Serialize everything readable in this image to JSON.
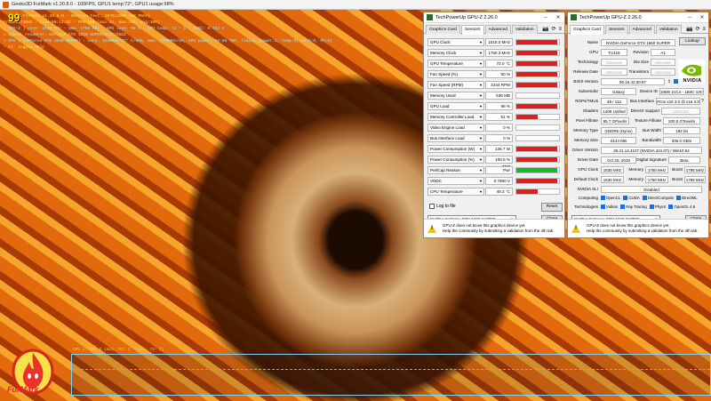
{
  "furmark": {
    "title": "Geeks3D FurMark v1.20.8.0 - 100FPS, GPU1 temp:72°, GPU1 usage:98%",
    "fps": "99",
    "lines": [
      "FurMark v1.20.8.0 - Burn-in test, 1576x1080 (0X MSAA)",
      "Frames:74882 - time:00:12:42 - FPS:100 (min:61, max:109, avg:100)",
      "[ GPU-Z ] core: 1530 MHz - mem: 1750 MHz - GPU load: 99 % - GPU temp: 72 ° C - VDDC: 0.762 V",
      "> OpenGL renderer: GeForce GTX 1660 SUPER/PCIe/SSE2",
      "> GPU 1 (GeForce GTX 1660 SUPER) - core: 1530MHz/72° C/99%, mem: 1750MHz/6%, GPU power: 99.5% TDP, limits:[power:1, temp:0, volt:0, OV:0]",
      "- F1: toggle help"
    ],
    "graph_label": "GPU 1: 72° C (min: 53° C - max: 73° C)",
    "logo_text": "FurMark"
  },
  "gpuz_sensors": {
    "title": "TechPowerUp GPU-Z 2.26.0",
    "tabs": [
      "Graphics Card",
      "Sensors",
      "Advanced",
      "Validation"
    ],
    "active_tab": 1,
    "sensors": [
      {
        "name": "GPU Clock",
        "value": "1515.0 MHz",
        "fill": 0.95,
        "color": "#e31c1c"
      },
      {
        "name": "Memory Clock",
        "value": "1750.2 MHz",
        "fill": 0.95,
        "color": "#e31c1c"
      },
      {
        "name": "GPU Temperature",
        "value": "72.0 °C",
        "fill": 0.95,
        "color": "#e31c1c"
      },
      {
        "name": "Fan Speed (%)",
        "value": "50 %",
        "fill": 0.95,
        "color": "#e31c1c"
      },
      {
        "name": "Fan Speed (RPM)",
        "value": "2244 RPM",
        "fill": 0.95,
        "color": "#e31c1c"
      },
      {
        "name": "Memory Used",
        "value": "536 MB",
        "fill": 0.0,
        "color": "#e31c1c"
      },
      {
        "name": "GPU Load",
        "value": "98 %",
        "fill": 0.95,
        "color": "#e31c1c"
      },
      {
        "name": "Memory Controller Load",
        "value": "51 %",
        "fill": 0.5,
        "color": "#e31c1c"
      },
      {
        "name": "Video Engine Load",
        "value": "0 %",
        "fill": 0.0,
        "color": "#e31c1c"
      },
      {
        "name": "Bus Interface Load",
        "value": "0 %",
        "fill": 0.0,
        "color": "#e31c1c"
      },
      {
        "name": "Power Consumption (W)",
        "value": "125.7 W",
        "fill": 0.95,
        "color": "#e31c1c"
      },
      {
        "name": "Power Consumption (%)",
        "value": "100.6 % TDP",
        "fill": 0.95,
        "color": "#e31c1c"
      },
      {
        "name": "PerfCap Reason",
        "value": "Pwr",
        "fill": 0.95,
        "color": "#1ab52c"
      },
      {
        "name": "VDDC",
        "value": "0.7680 V",
        "fill": 0.95,
        "color": "#e31c1c"
      },
      {
        "name": "CPU Temperature",
        "value": "49.3 °C",
        "fill": 0.5,
        "color": "#e31c1c"
      }
    ],
    "log_label": "Log to file",
    "reset_label": "Reset",
    "device_select": "NVIDIA GeForce GTX 1660 SUPER",
    "close_label": "Close",
    "warn_line1": "GPU-Z does not know this graphics device yet.",
    "warn_line2": "Help the community by submitting a validation from the 4th tab."
  },
  "gpuz_card": {
    "title": "TechPowerUp GPU-Z 2.26.0",
    "tabs": [
      "Graphics Card",
      "Sensors",
      "Advanced",
      "Validation"
    ],
    "active_tab": 0,
    "name_label": "Name",
    "name_value": "NVIDIA GeForce GTX 1660 SUPER",
    "lookup_label": "Lookup",
    "gpu_label": "GPU",
    "gpu_value": "TU116",
    "revision_label": "Revision",
    "revision_value": "A1",
    "technology_label": "Technology",
    "technology_value": "Unknown",
    "die_size_label": "Die Size",
    "die_size_value": "Unknown",
    "release_label": "Release Date",
    "release_value": "Unknown",
    "transistors_label": "Transistors",
    "transistors_value": "Unknown",
    "bios_label": "BIOS Version",
    "bios_value": "90.16.42.00.87",
    "uefi_label": "UEFI",
    "subvendor_label": "Subvendor",
    "subvendor_value": "Galaxy",
    "device_id_label": "Device ID",
    "device_id_value": "10DE 21C4 - 1B4C 13C9",
    "rops_label": "ROPs/TMUs",
    "rops_value": "48 / 112",
    "bus_label": "Bus Interface",
    "bus_value": "PCIe x16 3.0 @ x16 3.0",
    "shaders_label": "Shaders",
    "shaders_value": "1408 Unified",
    "dx_label": "DirectX Support",
    "dx_value": "Unknown",
    "pixel_label": "Pixel Fillrate",
    "pixel_value": "85.7 GPixel/s",
    "texture_label": "Texture Fillrate",
    "texture_value": "200.0 GTexel/s",
    "memtype_label": "Memory Type",
    "memtype_value": "GDDR6 (Hynix)",
    "buswidth_label": "Bus Width",
    "buswidth_value": "192 bit",
    "memsize_label": "Memory Size",
    "memsize_value": "6144 MB",
    "bandwidth_label": "Bandwidth",
    "bandwidth_value": "336.0 GB/s",
    "driver_label": "Driver Version",
    "driver_value": "26.21.14.4107 (NVIDIA 441.07) / Win10 64",
    "driverdate_label": "Driver Date",
    "driverdate_value": "Oct 20, 2019",
    "sig_label": "Digital Signature",
    "sig_value": "Beta",
    "gpuclock_label": "GPU Clock",
    "gpuclock_value": "1530 MHz",
    "mem_label": "Memory",
    "mem_value": "1750 MHz",
    "boost_label": "Boost",
    "boost_value": "1785 MHz",
    "defclock_label": "Default Clock",
    "defclock_value": "1530 MHz",
    "defmem_value": "1750 MHz",
    "defboost_value": "1785 MHz",
    "sli_label": "NVIDIA SLI",
    "sli_value": "Disabled",
    "computing_label": "Computing",
    "computing": [
      "OpenCL",
      "CUDA",
      "DirectCompute",
      "DirectML"
    ],
    "technologies_label": "Technologies",
    "technologies": [
      "Vulkan",
      "Ray Tracing",
      "PhysX",
      "OpenGL 4.6"
    ],
    "device_select": "NVIDIA GeForce GTX 1660 SUPER",
    "close_label": "Close",
    "warn_line1": "GPU-Z does not know this graphics device yet.",
    "warn_line2": "Help the community by submitting a validation from the 4th tab.",
    "vendor_logo": "NVIDIA"
  }
}
